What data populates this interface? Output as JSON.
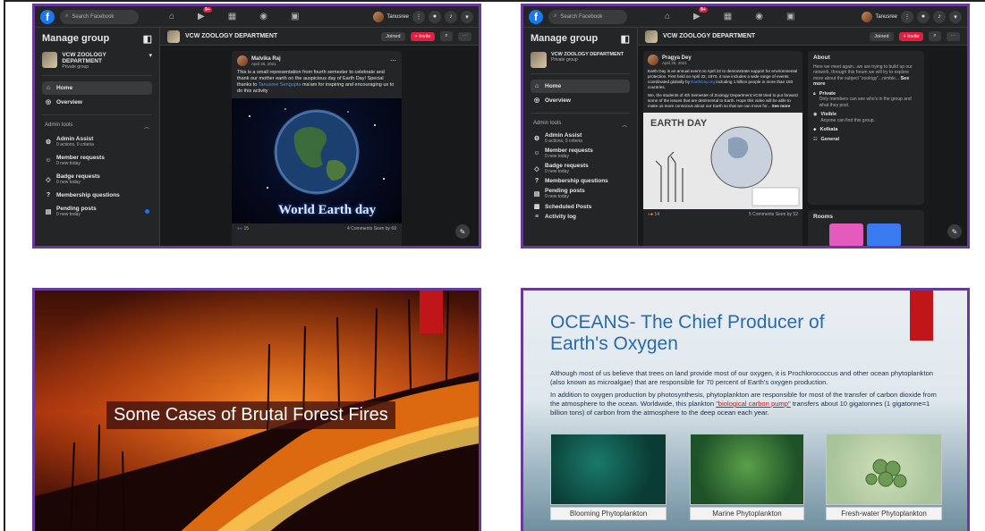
{
  "fb1": {
    "search_placeholder": "Search Facebook",
    "notif_count": "9+",
    "user": "Tanusree",
    "side_title": "Manage group",
    "group_name": "VCW ZOOLOGY DEPARTMENT",
    "group_privacy": "Private group",
    "nav": [
      {
        "label": "Home",
        "sub": ""
      },
      {
        "label": "Overview",
        "sub": ""
      }
    ],
    "admin_tools": "Admin tools",
    "tools": [
      {
        "label": "Admin Assist",
        "sub": "0 actions, 0 criteria"
      },
      {
        "label": "Member requests",
        "sub": "0 new today"
      },
      {
        "label": "Badge requests",
        "sub": "0 new today"
      },
      {
        "label": "Membership questions",
        "sub": ""
      },
      {
        "label": "Pending posts",
        "sub": "0 new today"
      }
    ],
    "header_title": "VCW ZOOLOGY DEPARTMENT",
    "joined": "Joined",
    "invite": "+ Invite",
    "post_author": "Malvika Raj",
    "post_date": "April 25, 2021",
    "post_text_1": "This is a small representation from fourth semester to celebrate and thank our mother earth on the auspicious day of Earth Day!",
    "post_text_2": "Special thanks to",
    "post_mention": "Tanusree Sengupta",
    "post_text_3": "ma'am for inspiring and encouraging us to do this activity",
    "post_image_text": "World Earth day",
    "reactions": "15",
    "post_stats": "4 Comments  Seen by 69"
  },
  "fb2": {
    "search_placeholder": "Search Facebook",
    "notif_count": "9+",
    "user": "Tanusree",
    "side_title": "Manage group",
    "group_name": "VCW ZOOLOGY DEPARTMENT",
    "group_privacy": "Private group",
    "nav": [
      {
        "label": "Home"
      },
      {
        "label": "Overview"
      }
    ],
    "admin_tools": "Admin tools",
    "tools": [
      {
        "label": "Admin Assist",
        "sub": "0 actions, 0 criteria"
      },
      {
        "label": "Member requests",
        "sub": "0 new today"
      },
      {
        "label": "Badge requests",
        "sub": "0 new today"
      },
      {
        "label": "Membership questions",
        "sub": ""
      },
      {
        "label": "Pending posts",
        "sub": "0 new today"
      },
      {
        "label": "Scheduled Posts",
        "sub": ""
      },
      {
        "label": "Activity log",
        "sub": ""
      }
    ],
    "header_title": "VCW ZOOLOGY DEPARTMENT",
    "joined": "Joined",
    "invite": "+ Invite",
    "post_author": "Pragya Dey",
    "post_date": "April 25, 2021",
    "post_text_1": "Earth Day is an annual event on April 22 to demonstrate support for environmental protection. First held on April 22, 1970, it now includes a wide range of events coordinated globally by",
    "post_link": "EarthDay.org",
    "post_text_2": "including 1 billion people in more than 193 countries.",
    "post_text_3": "We, the students of 4th Semester of Zoology Department,VCW tried to put forward some of the issues that are detrimental to Earth. Hope this video will be able to make us more conscious about our Earth so that we can move for...",
    "see_more": "See more",
    "post_image_text": "EARTH DAY",
    "reactions": "14",
    "post_stats": "5 Comments  Seen by 52",
    "about_title": "About",
    "about_text": "Here we meet again...we are trying to build up our network, through this forum we will try to explore more about the subject \"zoology\"...nimble...",
    "about_see_more": "See more",
    "private_title": "Private",
    "private_text": "Only members can see who's in the group and what they post.",
    "visible_title": "Visible",
    "visible_text": "Anyone can find this group.",
    "location": "Kolkata",
    "category": "General",
    "rooms_title": "Rooms"
  },
  "slide3": {
    "title": "Some Cases of Brutal Forest Fires"
  },
  "slide4": {
    "title_line1": "OCEANS- The Chief Producer of",
    "title_line2": "Earth's Oxygen",
    "para1": "Although most of us believe that trees on land provide most of our oxygen, it is Prochlorococcus and other ocean phytoplankton (also known as microalgae) that are responsible for 70 percent of Earth's oxygen production.",
    "para2_a": "In addition to oxygen production by photosynthesis, phytoplankton are responsible for most of the transfer of carbon dioxide from the atmosphere to the ocean. Worldwide, this plankton",
    "para2_hl": "\"biological carbon pump\"",
    "para2_b": "transfers about 10 gigatonnes (1 gigatonne=1 billion tons) of carbon from the atmosphere to the deep ocean each year.",
    "captions": [
      "Blooming Phytoplankton",
      "Marine Phytoplankton",
      "Fresh-water Phytoplankton"
    ]
  },
  "colors": {
    "frame": "#6a3a9a",
    "fb_bg": "#18191a",
    "fb_accent": "#1877f2",
    "invite_red": "#e41e3f",
    "ocean_title": "#2b6aa8"
  }
}
